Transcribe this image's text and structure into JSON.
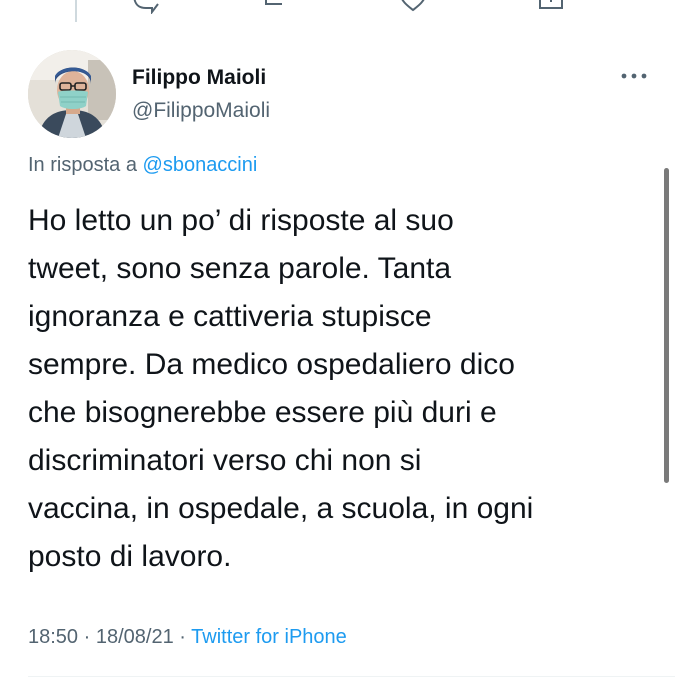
{
  "tweet": {
    "author_name": "Filippo Maioli",
    "author_handle": "@FilippoMaioli",
    "reply_prefix": "In risposta a",
    "reply_mention": "@sbonaccini",
    "text": "Ho letto un po’ di risposte al suo\ntweet, sono senza parole. Tanta\nignoranza e cattiveria stupisce\nsempre. Da medico ospedaliero dico\nche bisognerebbe essere più duri e\ndiscriminatori verso chi non si\nvaccina, in ospedale, a scuola, in ogni\nposto di lavoro.",
    "time": "18:50",
    "date": "18/08/21",
    "source": "Twitter for iPhone",
    "separator": "·"
  },
  "icons": {
    "reply": "reply-icon",
    "retweet": "retweet-icon",
    "like": "like-icon",
    "share": "share-icon",
    "more": "more-icon",
    "avatar": "avatar"
  },
  "colors": {
    "link": "#1d9bf0",
    "secondary_text": "#536471",
    "primary_text": "#0f1419"
  }
}
